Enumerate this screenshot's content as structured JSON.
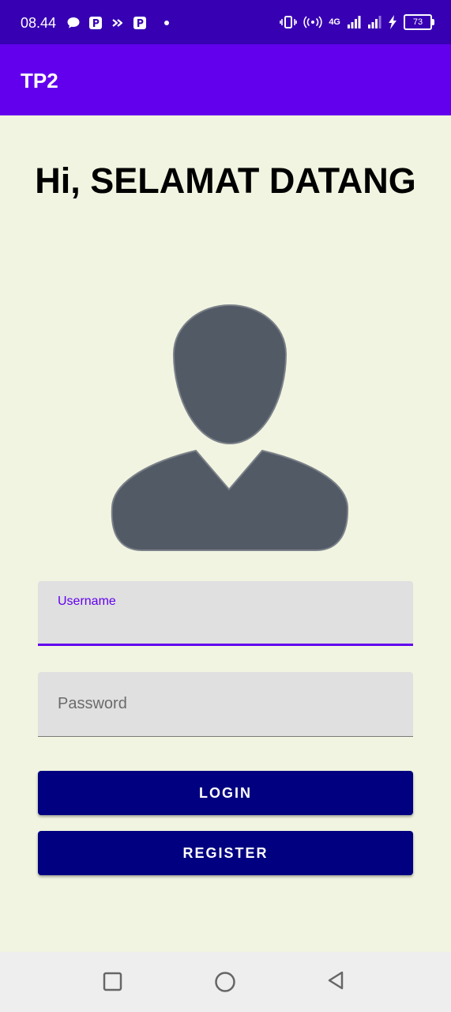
{
  "status_bar": {
    "time": "08.44",
    "notification_icons": [
      "chat-bubble-icon",
      "p-app-icon",
      "link-icon",
      "p-app-icon"
    ],
    "network_label": "4G",
    "battery_level": "73"
  },
  "app_bar": {
    "title": "TP2",
    "color": "#6200ee"
  },
  "welcome_text": "Hi, SELAMAT DATANG",
  "avatar_icon": "person-avatar-icon",
  "username_field": {
    "label": "Username",
    "value": ""
  },
  "password_field": {
    "placeholder": "Password",
    "value": ""
  },
  "buttons": {
    "login": "LOGIN",
    "register": "REGISTER",
    "color": "#000080"
  },
  "nav_bar": {
    "icons": [
      "square-recents-icon",
      "circle-home-icon",
      "triangle-back-icon"
    ]
  }
}
